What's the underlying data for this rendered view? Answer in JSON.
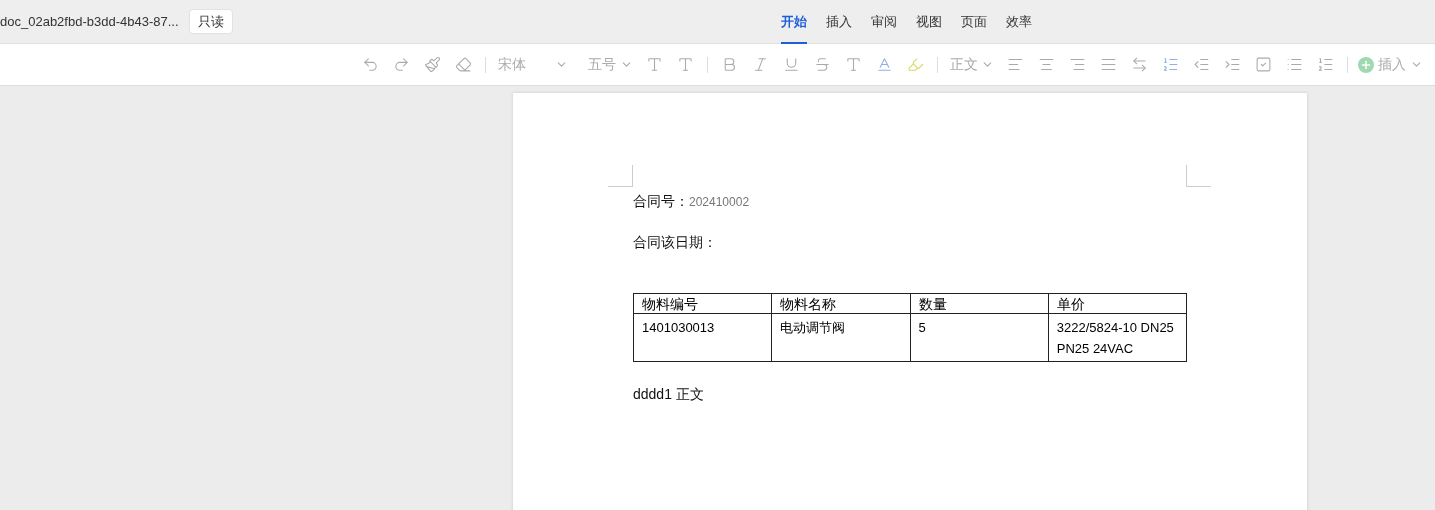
{
  "header": {
    "filename": "doc_02ab2fbd-b3dd-4b43-87...",
    "badge": "只读"
  },
  "tabs": [
    {
      "label": "开始",
      "selected": true
    },
    {
      "label": "插入",
      "selected": false
    },
    {
      "label": "审阅",
      "selected": false
    },
    {
      "label": "视图",
      "selected": false
    },
    {
      "label": "页面",
      "selected": false
    },
    {
      "label": "效率",
      "selected": false
    }
  ],
  "toolbar": {
    "disabled": true,
    "font": "宋体",
    "size": "五号",
    "style": "正文",
    "insert": "插入"
  },
  "document": {
    "contract_no_label": "合同号：",
    "contract_no": "202410002",
    "date_label": "合同该日期：",
    "table": {
      "columns": [
        "物料编号",
        "物料名称",
        "数量",
        "单价"
      ],
      "rows": [
        [
          "1401030013",
          "电动调节阀",
          "5",
          "3222/5824-10 DN25 PN25 24VAC"
        ]
      ]
    },
    "body": "dddd1 正文"
  }
}
